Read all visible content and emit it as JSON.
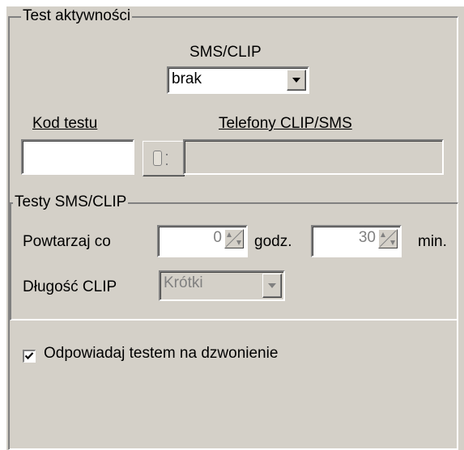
{
  "activity_test": {
    "title": "Test aktywności",
    "sms_clip_label": "SMS/CLIP",
    "sms_clip_value": "brak",
    "test_code_label": "Kod testu",
    "test_code_value": "",
    "phones_label": "Telefony CLIP/SMS",
    "phones_value": ""
  },
  "sms_clip_tests": {
    "title": "Testy SMS/CLIP",
    "repeat_label": "Powtarzaj co",
    "hours_value": "0",
    "hours_unit": "godz.",
    "minutes_value": "30",
    "minutes_unit": "min.",
    "clip_length_label": "Długość CLIP",
    "clip_length_value": "Krótki"
  },
  "respond_with_test": {
    "label": "Odpowiadaj testem na dzwonienie",
    "checked": true
  }
}
